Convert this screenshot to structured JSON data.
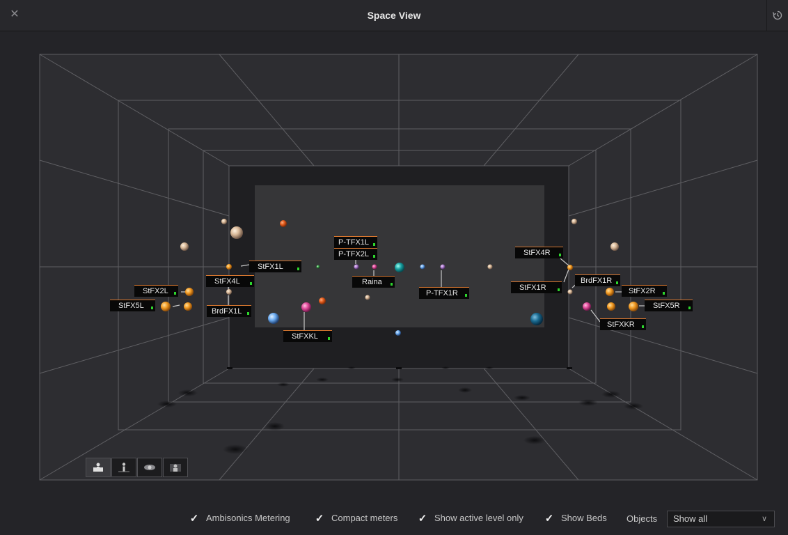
{
  "window": {
    "title": "Space View"
  },
  "icons": {
    "close": "close-icon",
    "reset": "reset-view-icon",
    "views": [
      "front-view-icon",
      "side-view-icon",
      "top-view-icon",
      "rear-view-icon"
    ],
    "checkmark": "checkmark-icon",
    "dropdown": "chevron-down-icon"
  },
  "objects_labels": [
    "P-TFX1L",
    "P-TFX2L",
    "Raina",
    "P-TFX1R",
    "StFX1L",
    "StFX4L",
    "BrdFX1L",
    "StFX2L",
    "StFX5L",
    "StFXKL",
    "StFX4R",
    "StFX1R",
    "BrdFX1R",
    "StFX2R",
    "StFX5R",
    "StFXKR"
  ],
  "footer": {
    "ambisonics_metering": {
      "label": "Ambisonics Metering",
      "checked": true
    },
    "compact_meters": {
      "label": "Compact meters",
      "checked": true
    },
    "show_active_level_only": {
      "label": "Show active level only",
      "checked": true
    },
    "show_beds": {
      "label": "Show Beds",
      "checked": true
    },
    "objects_label": "Objects",
    "objects_select": "Show all"
  },
  "colors": {
    "background": "#242428",
    "label_accent": "#d6762f",
    "meter_green": "#2dd62d"
  }
}
